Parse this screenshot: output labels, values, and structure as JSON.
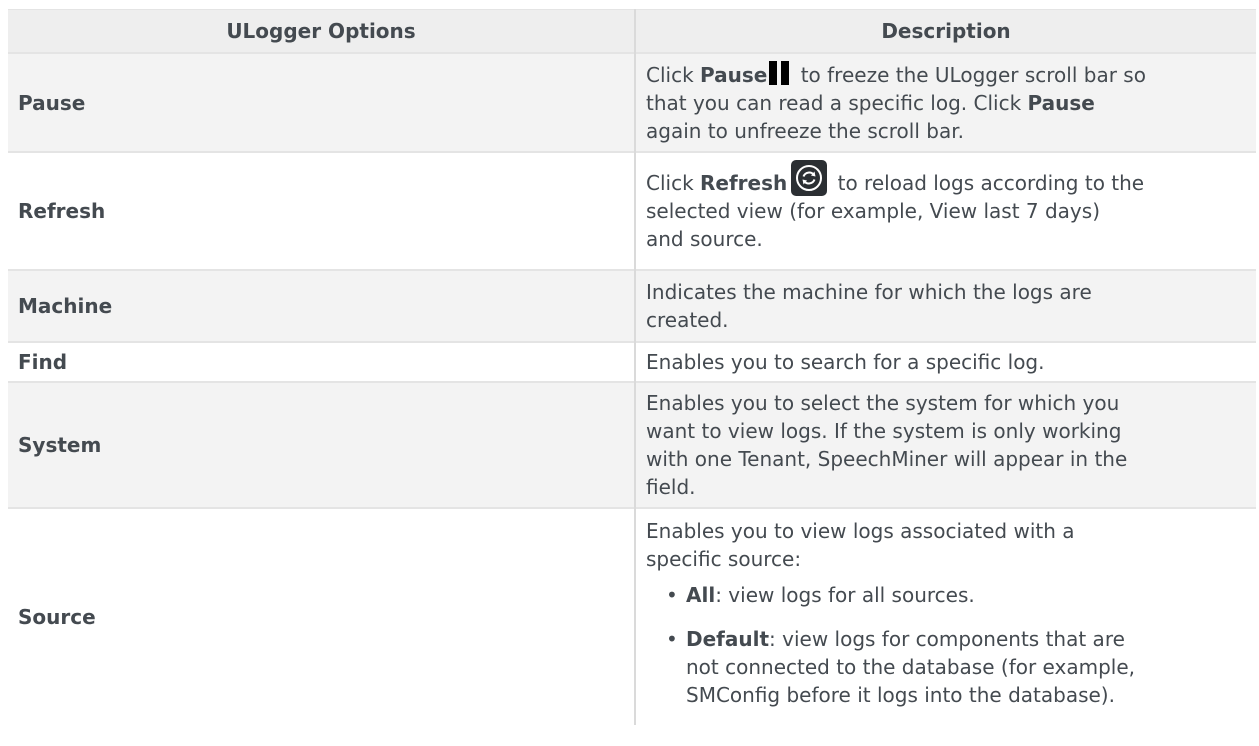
{
  "table": {
    "headers": {
      "option": "ULogger Options",
      "description": "Description"
    },
    "rows": {
      "pause": {
        "option": "Pause",
        "d1": "Click ",
        "d_bold1": "Pause",
        "d2": " to freeze the ULogger scroll bar so\n that you can read a specific log. Click ",
        "d_bold2": "Pause",
        "d3": "\n again to unfreeze the scroll bar."
      },
      "refresh": {
        "option": "Refresh",
        "d1": "Click ",
        "d_bold1": "Refresh",
        "d2": " to reload logs according to the\n selected view (for example, View last 7 days)\n and source."
      },
      "machine": {
        "option": "Machine",
        "d1": "Indicates the machine for which the logs are\n created."
      },
      "find": {
        "option": "Find",
        "d1": "Enables you to search for a specific log."
      },
      "system": {
        "option": "System",
        "d1": "Enables you to select the system for which you\n want to view logs. If the system is only working\n with one Tenant, SpeechMiner will appear in the\n field."
      },
      "source": {
        "option": "Source",
        "d1": "Enables you to view logs associated with a\n specific source:",
        "items": [
          {
            "bold": "All",
            "text": ": view logs for all sources."
          },
          {
            "bold": "Default",
            "text": ": view logs for components that are\n not connected to the database (for example,\n SMConfig before it logs into the database)."
          }
        ]
      }
    }
  },
  "icons": {
    "pause": "pause-icon",
    "refresh": "refresh-icon"
  },
  "colors": {
    "header_bg": "#eeeeee",
    "shaded_row_bg": "#f3f3f3",
    "text": "#444a50",
    "refresh_icon_bg": "#2b2f33"
  }
}
